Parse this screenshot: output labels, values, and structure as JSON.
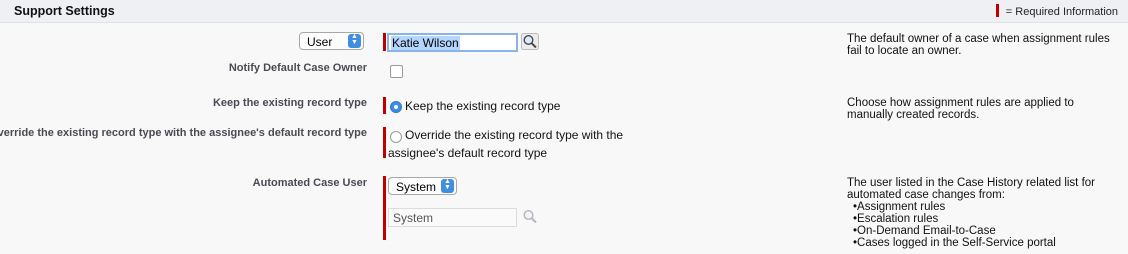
{
  "section": {
    "title": "Support Settings",
    "required_legend": "= Required Information"
  },
  "default_case_owner": {
    "owner_type_select": "User",
    "owner_value": "Katie Wilson",
    "help": "The default owner of a case when assignment rules fail to locate an owner."
  },
  "notify_default_owner": {
    "label": "Notify Default Case Owner",
    "checked": false
  },
  "record_type": {
    "keep_label": "Keep the existing record type",
    "keep_option": "Keep the existing record type",
    "override_label": "Override the existing record type with the assignee's default record type",
    "override_option": "Override the existing record type with the assignee's default record type",
    "selected": "keep",
    "help": "Choose how assignment rules are applied to manually created records."
  },
  "automated_case_user": {
    "label": "Automated Case User",
    "type_select": "System",
    "value": "System",
    "help_intro": "The user listed in the Case History related list for automated case changes from:",
    "help_items": [
      "Assignment rules",
      "Escalation rules",
      "On-Demand Email-to-Case",
      "Cases logged in the Self-Service portal"
    ]
  },
  "colors": {
    "required": "#c00000",
    "accent": "#3f8ee0",
    "header_bg": "#eef0f3"
  }
}
